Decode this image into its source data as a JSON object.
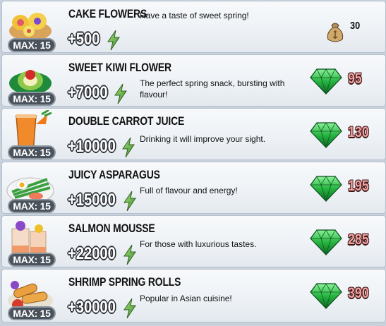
{
  "items": [
    {
      "title": "CAKE FLOWERS",
      "max": "MAX: 15",
      "energy": "+500",
      "desc": "Have a taste of sweet spring!",
      "price": "30",
      "currency": "coin-bag-icon",
      "food_icon": "cake-flowers-icon"
    },
    {
      "title": "SWEET KIWI FLOWER",
      "max": "MAX: 15",
      "energy": "+7000",
      "desc": "The perfect spring snack, bursting with flavour!",
      "price": "95",
      "currency": "emerald-icon",
      "food_icon": "kiwi-flower-icon"
    },
    {
      "title": "DOUBLE CARROT JUICE",
      "max": "MAX: 15",
      "energy": "+10000",
      "desc": "Drinking it will improve your sight.",
      "price": "130",
      "currency": "emerald-icon",
      "food_icon": "carrot-juice-icon"
    },
    {
      "title": "JUICY ASPARAGUS",
      "max": "MAX: 15",
      "energy": "+15000",
      "desc": "Full of flavour and energy!",
      "price": "195",
      "currency": "emerald-icon",
      "food_icon": "asparagus-icon"
    },
    {
      "title": "SALMON MOUSSE",
      "max": "MAX: 15",
      "energy": "+22000",
      "desc": "For those with luxurious tastes.",
      "price": "285",
      "currency": "emerald-icon",
      "food_icon": "salmon-mousse-icon"
    },
    {
      "title": "SHRIMP SPRING ROLLS",
      "max": "MAX: 15",
      "energy": "+30000",
      "desc": "Popular in Asian cuisine!",
      "price": "390",
      "currency": "emerald-icon",
      "food_icon": "spring-rolls-icon"
    }
  ],
  "colors": {
    "price_gem": "#f2a0a0",
    "emerald": "#2fc44d",
    "energy_bolt": "#6fc04a",
    "row_bg": "#eef2f6"
  }
}
